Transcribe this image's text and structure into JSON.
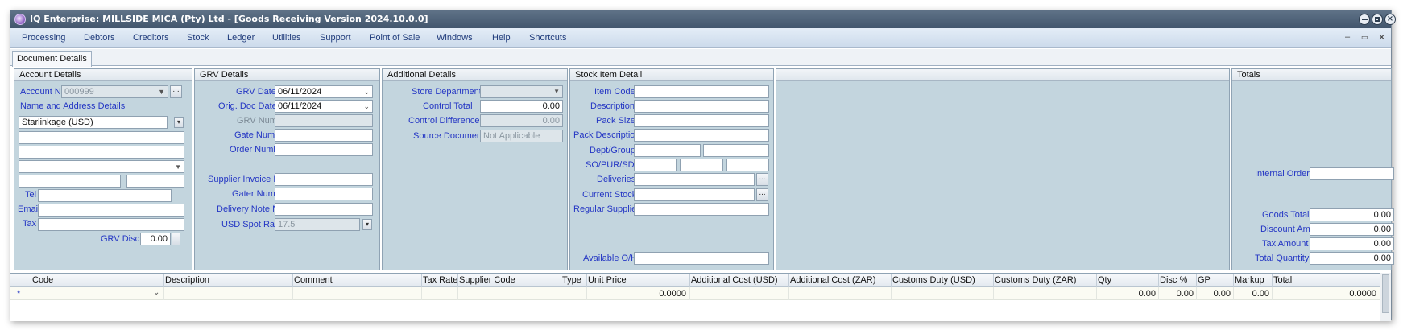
{
  "window": {
    "title": "IQ Enterprise: MILLSIDE MICA (Pty) Ltd - [Goods Receiving Version 2024.10.0.0]",
    "controls": [
      "minimize-icon",
      "maximize-icon",
      "close-icon"
    ]
  },
  "menu": {
    "items": [
      "Processing",
      "Debtors",
      "Creditors",
      "Stock",
      "Ledger",
      "Utilities",
      "Support",
      "Point of Sale",
      "Windows",
      "Help",
      "Shortcuts"
    ],
    "mdi_controls": [
      "–",
      "▭",
      "✕"
    ]
  },
  "tabs": [
    "Document Details"
  ],
  "account": {
    "header": "Account Details",
    "account_no_label": "Account No",
    "account_no_value": "000999",
    "name_address_label": "Name and Address Details",
    "name_value": "Starlinkage (USD)",
    "tel_label": "Tel",
    "email_label": "Email",
    "tax_label": "Tax",
    "grv_disc_label": "GRV Disc %",
    "grv_disc_value": "0.00"
  },
  "grv": {
    "header": "GRV Details",
    "grv_date_label": "GRV Date",
    "grv_date_value": "06/11/2024",
    "orig_doc_date_label": "Orig. Doc Date",
    "orig_doc_date_value": "06/11/2024",
    "grv_number_label": "GRV Number",
    "gate_number_label": "Gate Number",
    "order_number_label": "Order Number",
    "supplier_invoice_label": "Supplier Invoice No",
    "gater_number_label": "Gater Number",
    "delivery_note_label": "Delivery Note No",
    "usd_spot_rate_label": "USD Spot Rate",
    "usd_spot_rate_value": "17.5"
  },
  "additional": {
    "header": "Additional Details",
    "store_department_label": "Store Department",
    "control_total_label": "Control Total",
    "control_total_value": "0.00",
    "control_difference_label": "Control Difference",
    "control_difference_value": "0.00",
    "source_document_label": "Source Document",
    "source_document_value": "Not Applicable"
  },
  "stock": {
    "header": "Stock Item Detail",
    "item_code_label": "Item Code",
    "description_label": "Description",
    "pack_size_label": "Pack Size",
    "pack_description_label": "Pack Description",
    "dept_group_label": "Dept/Group",
    "so_pur_sdn_label": "SO/PUR/SDN",
    "deliveries_label": "Deliveries",
    "current_stock_label": "Current Stock",
    "regular_supplier_label": "Regular Supplier",
    "available_oh_label": "Available O/H"
  },
  "totals": {
    "header": "Totals",
    "internal_order_label": "Internal Order",
    "goods_total_label": "Goods Total",
    "goods_total_value": "0.00",
    "discount_amnt_label": "Discount Amnt",
    "discount_amnt_value": "0.00",
    "tax_amount_label": "Tax Amount",
    "tax_amount_value": "0.00",
    "total_quantity_label": "Total Quantity",
    "total_quantity_value": "0.00"
  },
  "grid": {
    "columns": [
      "Code",
      "Description",
      "Comment",
      "Tax Rate",
      "Supplier Code",
      "Type",
      "Unit Price",
      "Additional Cost (USD)",
      "Additional Cost (ZAR)",
      "Customs Duty (USD)",
      "Customs Duty (ZAR)",
      "Qty",
      "Disc %",
      "GP",
      "Markup",
      "Total"
    ],
    "new_row": {
      "marker": "*",
      "unit_price": "0.0000",
      "qty": "0.00",
      "disc": "0.00",
      "gp": "0.00",
      "markup": "0.00",
      "total": "0.0000"
    }
  },
  "colors": {
    "title_bar": "#4f6379",
    "menu_bar": "#d6e2f0",
    "panel_bg": "#c3d5de",
    "label_text": "#2436c4"
  }
}
